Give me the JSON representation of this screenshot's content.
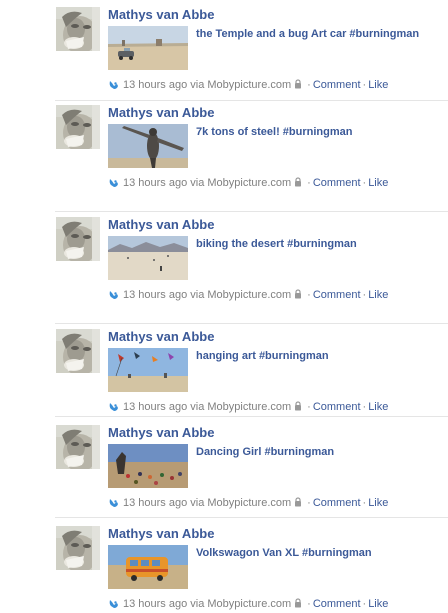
{
  "posts": [
    {
      "author": "Mathys van Abbe",
      "caption": "the Temple and a bug Art car #burningman",
      "time": "13 hours ago",
      "via": "via Mobypicture.com",
      "comment": "Comment",
      "like": "Like",
      "photo": "temple"
    },
    {
      "author": "Mathys van Abbe",
      "caption": "7k tons of steel! #burningman",
      "time": "13 hours ago",
      "via": "via Mobypicture.com",
      "comment": "Comment",
      "like": "Like",
      "photo": "steel"
    },
    {
      "author": "Mathys van Abbe",
      "caption": "biking the desert #burningman",
      "time": "13 hours ago",
      "via": "via Mobypicture.com",
      "comment": "Comment",
      "like": "Like",
      "photo": "desert"
    },
    {
      "author": "Mathys van Abbe",
      "caption": "hanging art #burningman",
      "time": "13 hours ago",
      "via": "via Mobypicture.com",
      "comment": "Comment",
      "like": "Like",
      "photo": "hanging"
    },
    {
      "author": "Mathys van Abbe",
      "caption": "Dancing Girl #burningman",
      "time": "13 hours ago",
      "via": "via Mobypicture.com",
      "comment": "Comment",
      "like": "Like",
      "photo": "dancing"
    },
    {
      "author": "Mathys van Abbe",
      "caption": "Volkswagon Van XL #burningman",
      "time": "13 hours ago",
      "via": "via Mobypicture.com",
      "comment": "Comment",
      "like": "Like",
      "photo": "van"
    }
  ],
  "icons": {
    "app": "mobypicture-app-icon",
    "privacy": "lock-icon"
  },
  "colors": {
    "link": "#3b5998",
    "meta": "#808080",
    "separator": "#e5e5e5"
  }
}
